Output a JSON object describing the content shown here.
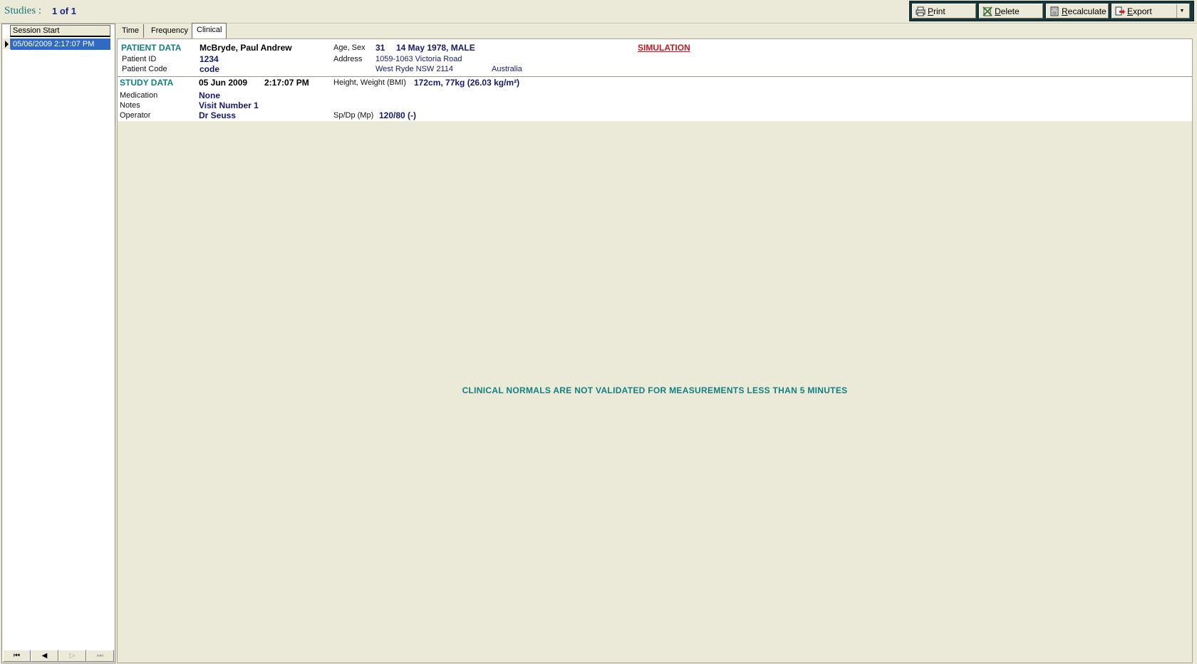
{
  "header": {
    "studies_label": "Studies :",
    "studies_count": "1 of 1"
  },
  "toolbar": {
    "print": "Print",
    "delete": "Delete",
    "recalculate": "Recalculate",
    "export": "Export"
  },
  "sessions": {
    "column_header": "Session Start",
    "rows": [
      "05/06/2009 2:17:07 PM"
    ]
  },
  "tabs": [
    "Time",
    "Frequency",
    "Clinical"
  ],
  "patient": {
    "section_title": "PATIENT DATA",
    "name": "McBryde, Paul Andrew",
    "age_sex_label": "Age, Sex",
    "age": "31",
    "dob_sex": "14 May 1978, MALE",
    "simulation": "SIMULATION",
    "id_label": "Patient ID",
    "id": "1234",
    "address_label": "Address",
    "address_line1": "1059-1063 Victoria Road",
    "code_label": "Patient Code",
    "code": "code",
    "address_line2": "West Ryde NSW 2114",
    "country": "Australia"
  },
  "study": {
    "section_title": "STUDY DATA",
    "date": "05 Jun 2009",
    "time": "2:17:07 PM",
    "hw_label": "Height, Weight (BMI)",
    "hw_value": "172cm, 77kg (26.03 kg/m²)",
    "medication_label": "Medication",
    "medication": "None",
    "notes_label": "Notes",
    "notes": "Visit Number 1",
    "operator_label": "Operator",
    "operator": "Dr Seuss",
    "bp_label": "Sp/Dp (Mp)",
    "bp_value": "120/80 (-)"
  },
  "message": "CLINICAL NORMALS ARE NOT VALIDATED FOR MEASUREMENTS LESS THAN 5 MINUTES",
  "navigator": {
    "first": "⏮",
    "prev": "◀",
    "next": "▷",
    "last": "⏭"
  },
  "colors": {
    "teal": "#128080",
    "navy": "#151a6e",
    "selection": "#316ac5",
    "alert": "#c8181e"
  }
}
